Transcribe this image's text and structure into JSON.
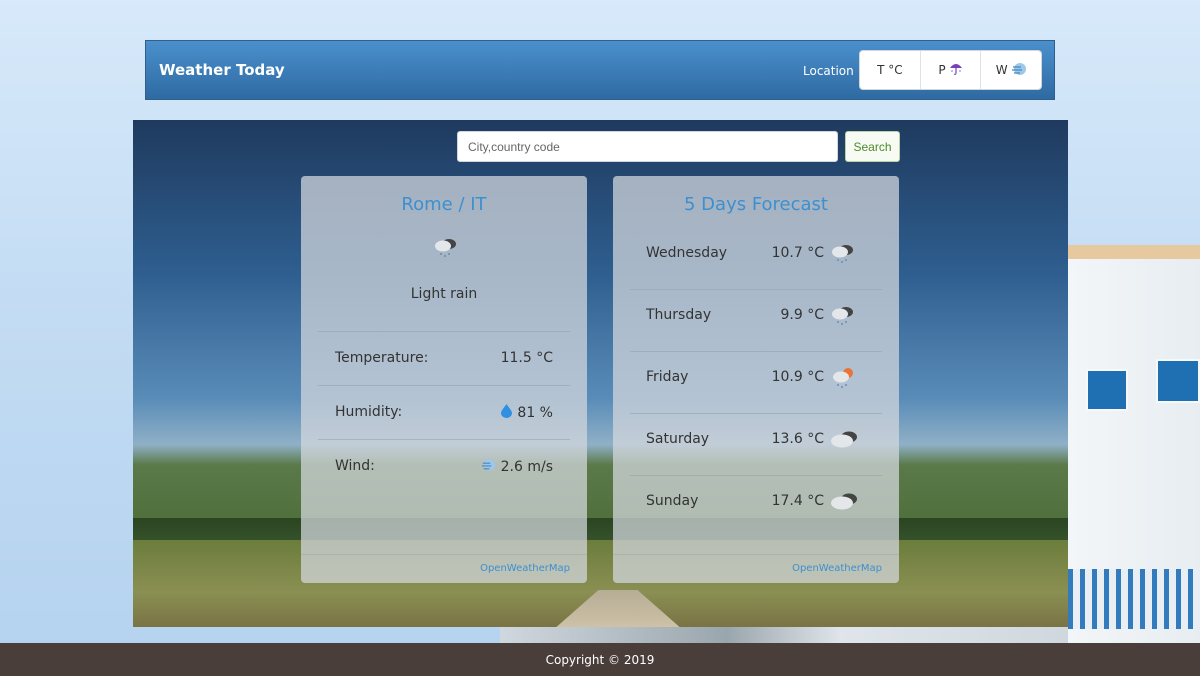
{
  "navbar": {
    "brand": "Weather Today",
    "location_label": "Location",
    "buttons": [
      {
        "label": "T °C",
        "icon": ""
      },
      {
        "label": "P",
        "icon": "umbrella-rain-icon"
      },
      {
        "label": "W",
        "icon": "wind-icon"
      }
    ]
  },
  "search": {
    "placeholder": "City,country code",
    "button_label": "Search"
  },
  "current": {
    "title": "Rome / IT",
    "icon": "light-rain-icon",
    "description": "Light rain",
    "stats": [
      {
        "label": "Temperature:",
        "value": "11.5 °C",
        "icon": ""
      },
      {
        "label": "Humidity:",
        "value": "81 %",
        "icon": "water-drop-icon"
      },
      {
        "label": "Wind:",
        "value": "2.6 m/s",
        "icon": "wind-icon"
      }
    ],
    "source_link": "OpenWeatherMap"
  },
  "forecast": {
    "title": "5 Days Forecast",
    "days": [
      {
        "day": "Wednesday",
        "temp": "10.7 °C",
        "icon": "rain-cloud-icon"
      },
      {
        "day": "Thursday",
        "temp": "9.9 °C",
        "icon": "rain-cloud-icon"
      },
      {
        "day": "Friday",
        "temp": "10.9 °C",
        "icon": "sun-rain-icon"
      },
      {
        "day": "Saturday",
        "temp": "13.6 °C",
        "icon": "cloudy-icon"
      },
      {
        "day": "Sunday",
        "temp": "17.4 °C",
        "icon": "cloudy-icon"
      }
    ],
    "source_link": "OpenWeatherMap"
  },
  "footer": {
    "copyright": "Copyright © 2019"
  },
  "colors": {
    "accent": "#3d8fd0",
    "navbar": "#3a7cba",
    "footer": "#4a3e3b",
    "search_button_text": "#4c8a2a"
  }
}
